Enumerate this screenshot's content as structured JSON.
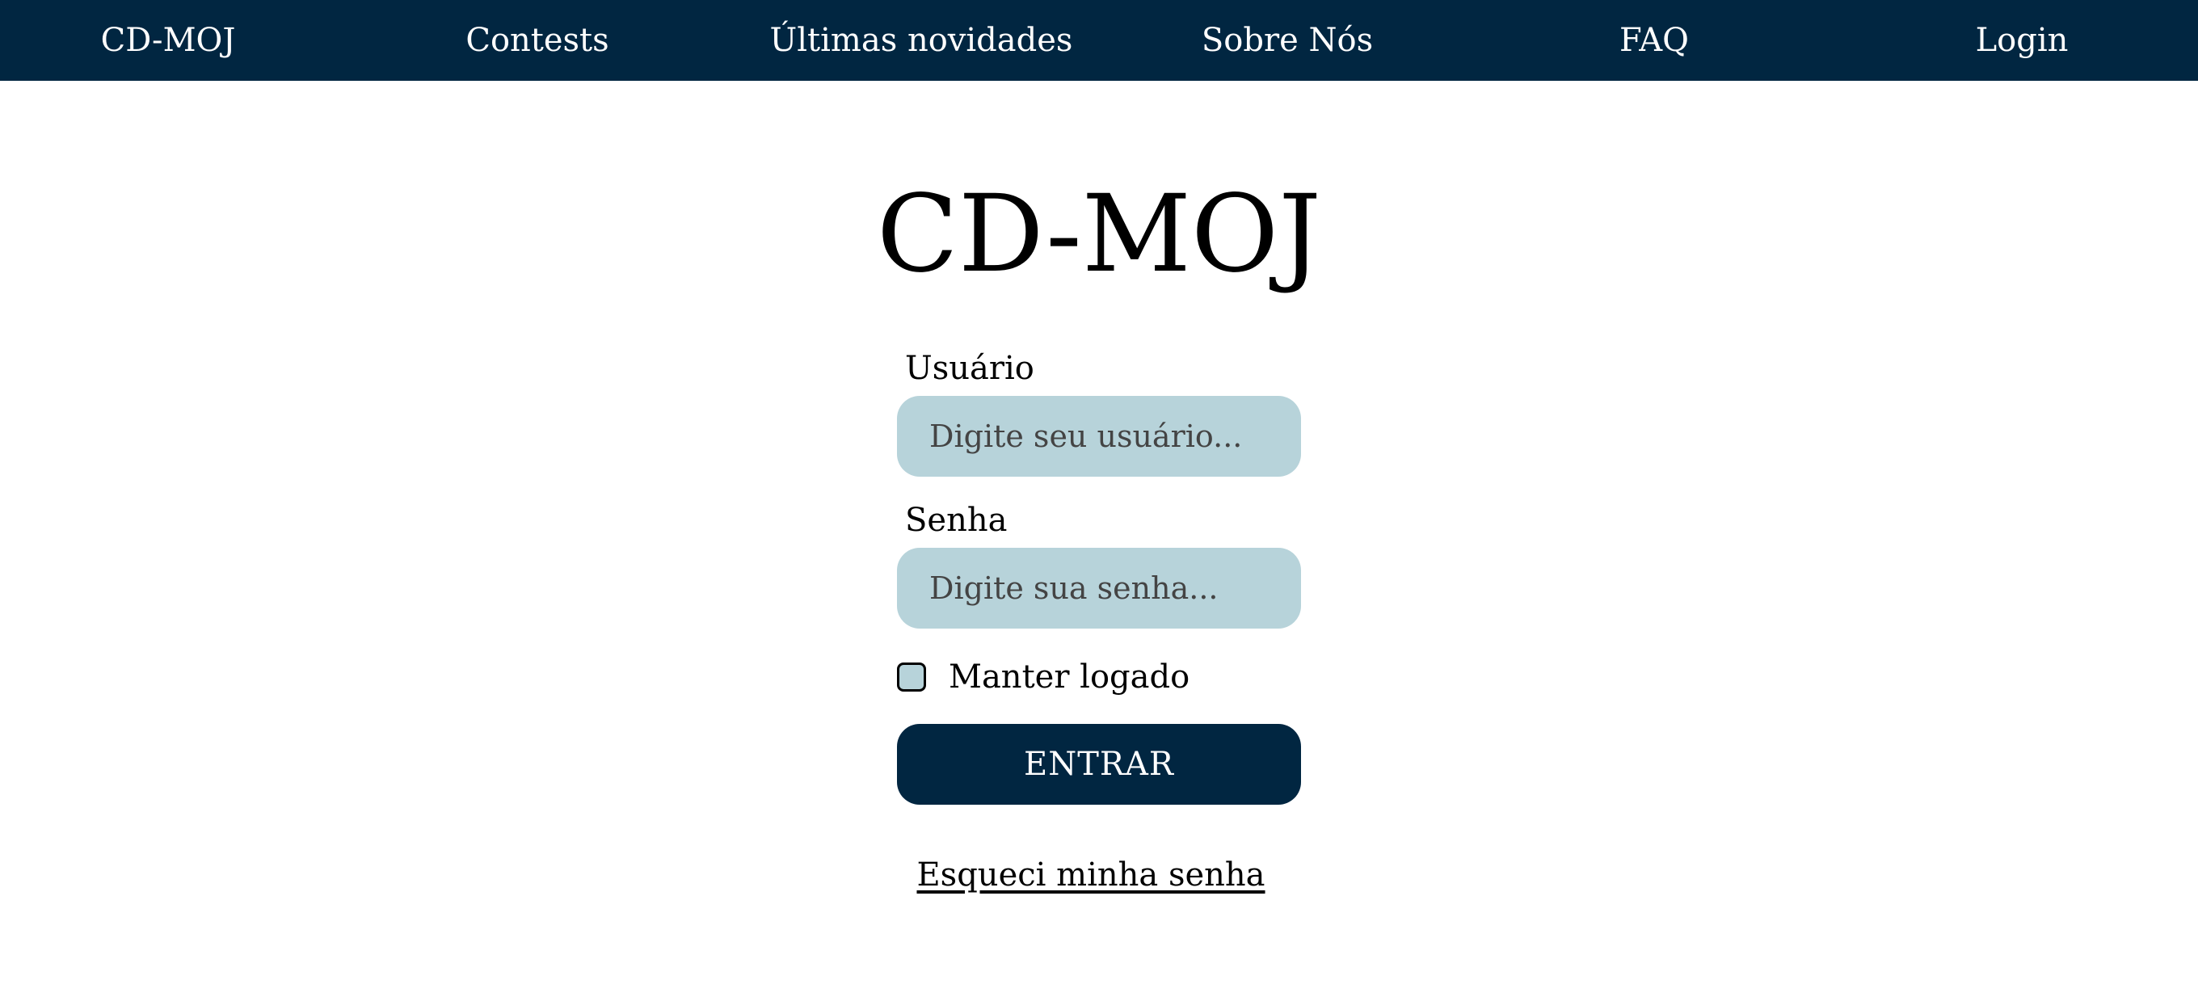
{
  "nav": {
    "brand": "CD-MOJ",
    "items": [
      {
        "label": "Contests"
      },
      {
        "label": "Últimas novidades"
      },
      {
        "label": "Sobre Nós"
      },
      {
        "label": "FAQ"
      },
      {
        "label": "Login"
      }
    ]
  },
  "main": {
    "title": "CD-MOJ",
    "form": {
      "user_label": "Usuário",
      "user_placeholder": "Digite seu usuário...",
      "user_value": "",
      "password_label": "Senha",
      "password_placeholder": "Digite sua senha...",
      "password_value": "",
      "remember_label": "Manter logado",
      "remember_checked": false,
      "submit_label": "ENTRAR",
      "forgot_label": "Esqueci minha senha"
    }
  },
  "colors": {
    "navbar": "#012641",
    "input_background": "#b7d3da",
    "button": "#012641",
    "page_background": "#ffffff"
  }
}
